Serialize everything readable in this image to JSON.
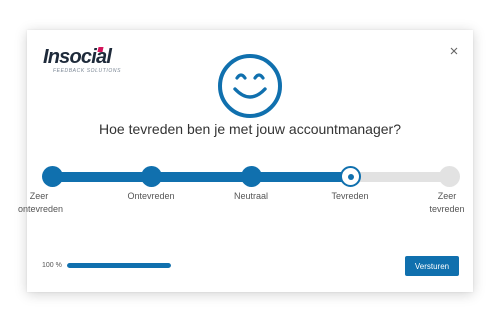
{
  "logo": {
    "name": "Insocial",
    "tagline": "FEEDBACK SOLUTIONS",
    "accent": "#d4145a"
  },
  "close": {
    "icon": "close-icon",
    "glyph": "×"
  },
  "face": {
    "icon": "smiley-face-icon",
    "color": "#1070ae"
  },
  "question": "Hoe tevreden ben je met jouw accountmanager?",
  "scale": {
    "options": [
      "Zeer ontevreden",
      "Ontevreden",
      "Neutraal",
      "Tevreden",
      "Zeer tevreden"
    ],
    "selected_index": 3,
    "accent": "#1070ae",
    "inactive": "#e2e2e2"
  },
  "progress": {
    "label": "100 %",
    "value": 1.0
  },
  "submit": {
    "label": "Versturen"
  }
}
